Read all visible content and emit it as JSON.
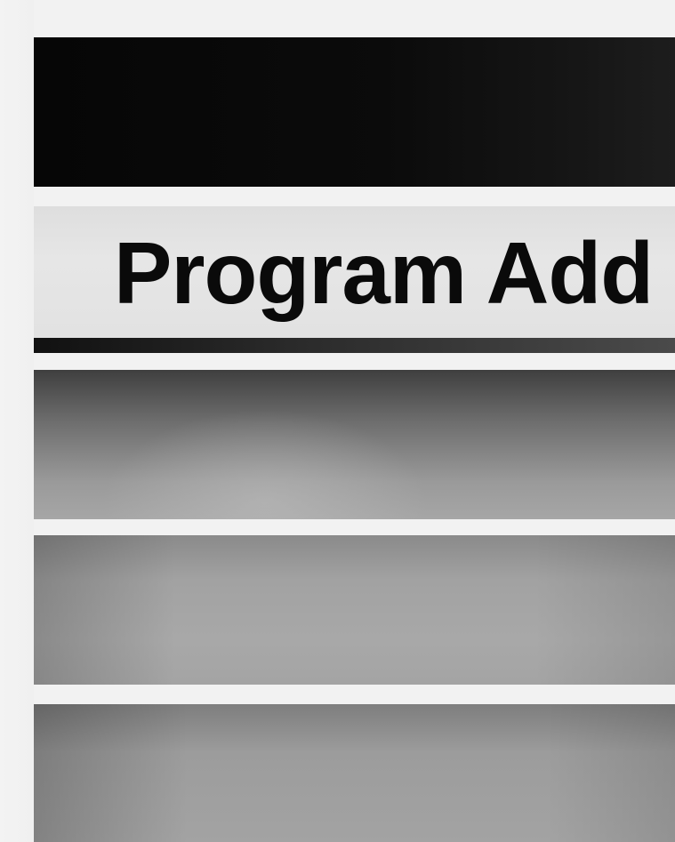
{
  "menu": {
    "title": "Program Add",
    "options": [
      {
        "label": ""
      },
      {
        "label": ""
      },
      {
        "label": ""
      }
    ]
  },
  "colors": {
    "header_bar": "#0b0b0b",
    "title_band": "#e2e2e2",
    "title_text": "#0a0a0a",
    "row_gray": "#a2a2a2"
  }
}
